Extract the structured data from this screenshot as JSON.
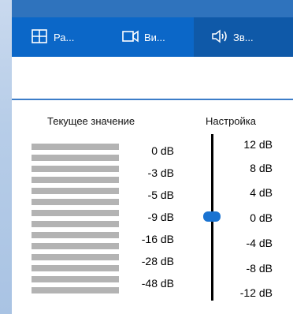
{
  "tabs": [
    {
      "label": "Ра...",
      "icon": "grid-icon"
    },
    {
      "label": "Ви...",
      "icon": "camera-icon"
    },
    {
      "label": "Зв...",
      "icon": "speaker-icon",
      "selected": true
    }
  ],
  "panel": {
    "current_header": "Текущее значение",
    "setting_header": "Настройка"
  },
  "current_levels": [
    "0 dB",
    "-3 dB",
    "-5 dB",
    "-9 dB",
    "-16 dB",
    "-28 dB",
    "-48 dB"
  ],
  "setting_ticks": [
    "12 dB",
    "8 dB",
    "4 dB",
    "0 dB",
    "-4 dB",
    "-8 dB",
    "-12 dB"
  ],
  "slider": {
    "value": "0 dB",
    "min": "-12 dB",
    "max": "12 dB"
  },
  "colors": {
    "toolbar": "#0b67c8",
    "selected_tab": "#0f59a8",
    "thumb": "#1a73d1",
    "bar": "#b3b3b3"
  }
}
